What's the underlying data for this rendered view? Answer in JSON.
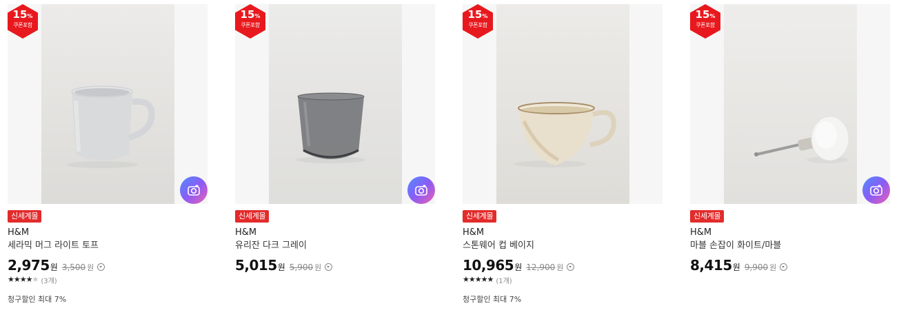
{
  "products": [
    {
      "coupon_percent": "15",
      "coupon_label": "쿠폰포함",
      "badge": "신세계몰",
      "brand": "H&M",
      "name": "세라믹 머그 라이트 토프",
      "price": "2,975",
      "currency": "원",
      "original_price": "3,500",
      "original_currency": "원",
      "rating_value": 4.5,
      "stars": "★★★★",
      "stars_half": "★",
      "review_count": "(3개)",
      "discount_note": "청구할인 최대 7%",
      "has_camera_icon": true
    },
    {
      "coupon_percent": "15",
      "coupon_label": "쿠폰포함",
      "badge": "신세계몰",
      "brand": "H&M",
      "name": "유리잔 다크 그레이",
      "price": "5,015",
      "currency": "원",
      "original_price": "5,900",
      "original_currency": "원",
      "has_camera_icon": true
    },
    {
      "coupon_percent": "15",
      "coupon_label": "쿠폰포함",
      "badge": "신세계몰",
      "brand": "H&M",
      "name": "스톤웨어 컵 베이지",
      "price": "10,965",
      "currency": "원",
      "original_price": "12,900",
      "original_currency": "원",
      "rating_value": 5,
      "stars": "★★★★★",
      "review_count": "(1개)",
      "discount_note": "청구할인 최대 7%",
      "has_camera_icon": false
    },
    {
      "coupon_percent": "15",
      "coupon_label": "쿠폰포함",
      "badge": "신세계몰",
      "brand": "H&M",
      "name": "마블 손잡이 화이트/마블",
      "price": "8,415",
      "currency": "원",
      "original_price": "9,900",
      "original_currency": "원",
      "has_camera_icon": true
    }
  ],
  "colors": {
    "badge_red": "#e22b2b",
    "coupon_red": "#e8191e",
    "camera_gradient_start": "#4f8cff",
    "camera_gradient_end": "#ec5fb1"
  },
  "icons": {
    "coupon": "hexagon-coupon-icon",
    "camera": "camera-icon",
    "info": "chevron-down-circle-icon",
    "star": "star-icon"
  }
}
